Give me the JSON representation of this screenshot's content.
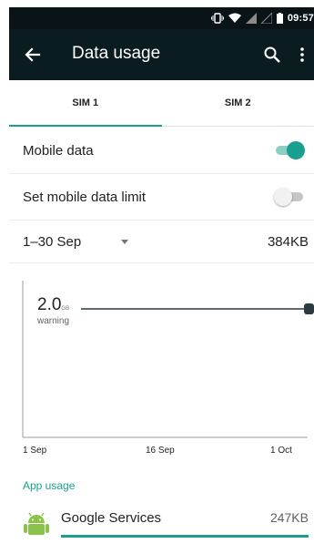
{
  "status_bar": {
    "time": "09:57"
  },
  "app_bar": {
    "title": "Data usage"
  },
  "tabs": [
    {
      "label": "SIM 1",
      "active": true
    },
    {
      "label": "SIM 2",
      "active": false
    }
  ],
  "settings": {
    "mobile_data": {
      "label": "Mobile data",
      "enabled": true
    },
    "data_limit": {
      "label": "Set mobile data limit",
      "enabled": false
    }
  },
  "cycle": {
    "range": "1–30 Sep",
    "total": "384KB"
  },
  "chart": {
    "warning_value": "2.0",
    "warning_unit": "GB",
    "warning_label": "warning",
    "x_labels": [
      "1 Sep",
      "16 Sep",
      "1 Oct"
    ]
  },
  "app_usage": {
    "heading": "App usage",
    "items": [
      {
        "name": "Google Services",
        "usage": "247KB"
      }
    ]
  },
  "colors": {
    "accent": "#1a9e8f",
    "app_bar": "#0b1c21",
    "status_bar": "#0a1418"
  }
}
